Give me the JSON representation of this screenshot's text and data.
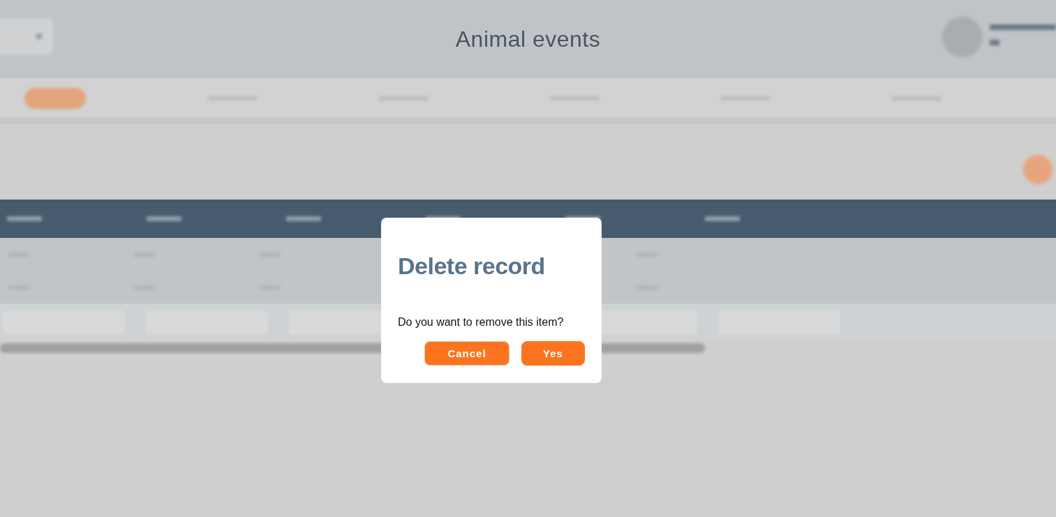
{
  "page": {
    "title": "Animal events"
  },
  "dialog": {
    "title": "Delete record",
    "message": "Do you want to remove this item?",
    "buttons": [
      {
        "label": "Cancel",
        "kind": "secondary"
      },
      {
        "label": "Yes",
        "kind": "primary"
      }
    ]
  }
}
